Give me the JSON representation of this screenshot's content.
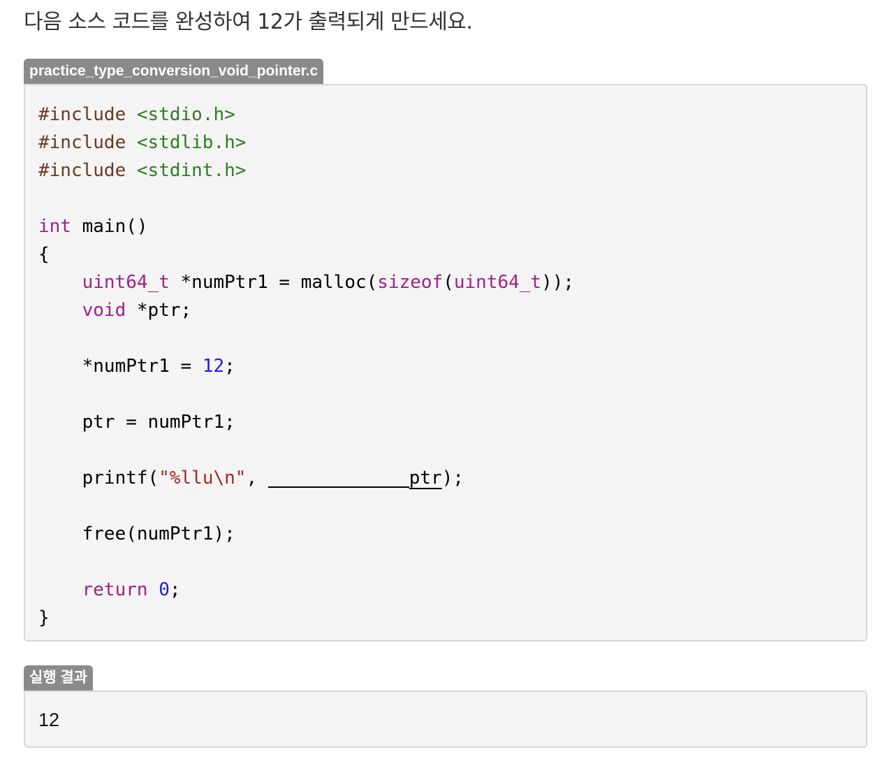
{
  "prompt": "다음 소스 코드를 완성하여 12가 출력되게 만드세요.",
  "file_tab": {
    "label": "practice_type_conversion_void_pointer.c"
  },
  "code": {
    "include_directive": "#include",
    "headers": [
      "<stdio.h>",
      "<stdlib.h>",
      "<stdint.h>"
    ],
    "main_type": "int",
    "main_sig": " main()",
    "open_brace": "{",
    "decl1_type": "uint64_t",
    "decl1_mid": " *numPtr1 = malloc(",
    "decl1_sizeof": "sizeof",
    "decl1_paren": "(",
    "decl1_argtype": "uint64_t",
    "decl1_end": "));",
    "decl2_type": "void",
    "decl2_rest": " *ptr;",
    "assign1_lhs": "*numPtr1 = ",
    "assign1_value": "12",
    "assign1_end": ";",
    "assign2": "ptr = numPtr1;",
    "printf_start": "printf(",
    "printf_format": "\"%llu\\n\"",
    "printf_comma": ", ",
    "printf_arg": "ptr",
    "printf_end": ");",
    "free_stmt": "free(numPtr1);",
    "return_kw": "return",
    "return_value": "0",
    "return_end": ";",
    "close_brace": "}",
    "indent": "    "
  },
  "result_tab": {
    "label": "실행 결과"
  },
  "result": {
    "output": "12"
  },
  "colors": {
    "preprocessor": "#6b3a1f",
    "header": "#2e7d20",
    "keyword": "#a0208a",
    "number": "#1f1fd0",
    "string": "#b22222",
    "tag_background": "#8a8a8a",
    "box_background": "#f4f4f4"
  }
}
